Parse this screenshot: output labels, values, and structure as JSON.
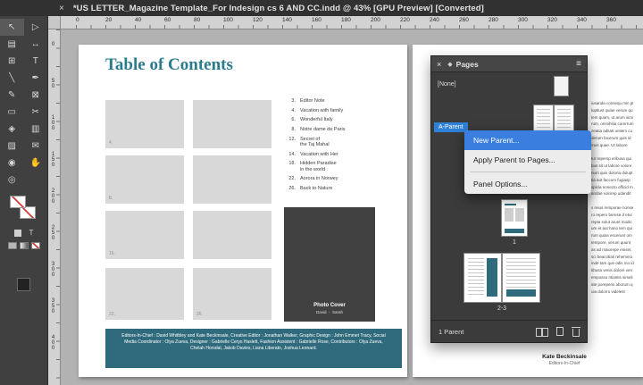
{
  "title_bar": {
    "close_glyph": "×",
    "title": "*US LETTER_Magazine Template_For Indesign cs 6 AND CC.indd @ 43% [GPU Preview] [Converted]"
  },
  "toolbar": {
    "tools": [
      {
        "name": "selection-tool",
        "glyph": "↖"
      },
      {
        "name": "direct-selection-tool",
        "glyph": "▷"
      },
      {
        "name": "page-tool",
        "glyph": "▤"
      },
      {
        "name": "gap-tool",
        "glyph": "↔"
      },
      {
        "name": "content-collector-tool",
        "glyph": "⊞"
      },
      {
        "name": "type-tool",
        "glyph": "T"
      },
      {
        "name": "line-tool",
        "glyph": "╲"
      },
      {
        "name": "pen-tool",
        "glyph": "✒"
      },
      {
        "name": "pencil-tool",
        "glyph": "✎"
      },
      {
        "name": "rectangle-frame-tool",
        "glyph": "⊠"
      },
      {
        "name": "rectangle-tool",
        "glyph": "▭"
      },
      {
        "name": "scissors-tool",
        "glyph": "✂"
      },
      {
        "name": "free-transform-tool",
        "glyph": "◈"
      },
      {
        "name": "gradient-swatch-tool",
        "glyph": "▥"
      },
      {
        "name": "gradient-feather-tool",
        "glyph": "▨"
      },
      {
        "name": "note-tool",
        "glyph": "✉"
      },
      {
        "name": "eyedropper-tool",
        "glyph": "◉"
      },
      {
        "name": "hand-tool",
        "glyph": "✋"
      },
      {
        "name": "zoom-tool",
        "glyph": "◎"
      },
      {
        "name": "blank-slot",
        "glyph": ""
      }
    ],
    "type_badge": "T"
  },
  "rulers": {
    "horizontal": [
      "0",
      "20",
      "40",
      "60",
      "80",
      "100",
      "120",
      "140",
      "160",
      "180",
      "200",
      "220",
      "240",
      "260",
      "280",
      "300",
      "320",
      "340",
      "360"
    ],
    "vertical": [
      "0",
      "50",
      "100",
      "150",
      "200",
      "250",
      "300",
      "350",
      "400"
    ]
  },
  "document": {
    "page1": {
      "title": "Table of Contents",
      "boxes": [
        "4.",
        "",
        "8.",
        "",
        "16.",
        "",
        "22.",
        "26."
      ],
      "toc": [
        {
          "num": "3.",
          "text": "Editor Note"
        },
        {
          "num": "4.",
          "text": "Vacation with family"
        },
        {
          "num": "6.",
          "text": "Wonderful Italy"
        },
        {
          "num": "8.",
          "text": "Notre dame de Paris"
        },
        {
          "num": "12.",
          "text": "Secret of\nthe Taj Mahal"
        },
        {
          "num": "14.",
          "text": "Vacation with Her"
        },
        {
          "num": "18.",
          "text": "Hidden Paradise\nin the world"
        },
        {
          "num": "22.",
          "text": "Aorora in Norwey"
        },
        {
          "num": "26.",
          "text": "Back to Nature"
        }
      ],
      "photo_cover": {
        "line1": "Photo Cover",
        "line2": "David  -  Sarah"
      },
      "footer": "Editors-In-Chief : David Whitbley and Kate Beckinsale, Creative Editor : Jonathan Walker, Graphic Design : John Emmet Tracy, Social Media Coordinator : Olya Zueva, Designer :  Gabrielle Cerys Haslett, Fashion Assistent : Gabrielle Rose, Contributors : Olya Zueva, Chelah Horsdal, Jakob Davies, Liana Liberato,  Joshua Leonard."
    },
    "page2": {
      "column_lines": [
        "iusanda consequ min pl",
        "luptiust quiae verum qu",
        "tem quam, ut arum simi",
        "rum, omnihitia corerrum",
        "zeatia aditati untiem cu",
        "derum facerum quis id",
        "mos quae. Ut labore",
        "",
        "tur repersp eribusa qui",
        "bus sit ut labore volore",
        "num quis doloria dolupt",
        "tia aut faccum fugiasp",
        "spicia nonecto officid m",
        "andae volorep udandit",
        "",
        "s reius remporae nonse",
        "ro repero berese d etur",
        "repta solut arunt modic",
        "um et aut hario tem qui",
        "rum quias escerunt om",
        "tempore, verum quunt",
        "as ad maiorepe eniset.",
        "sci bearcitiati rehemino",
        "inde tam que odis mo id",
        "tibusa venis dolore verr",
        "empossu ntiantis simeli",
        "ate poreperis aborum q",
        "uia dolorro videlest"
      ],
      "caption_name": "Kate Beckinsale",
      "caption_role": "Editors-In-Chief"
    }
  },
  "pages_panel": {
    "close_glyph": "×",
    "panel_icon": "◆",
    "title": "Pages",
    "menu_icon": "≡",
    "none_label": "[None]",
    "parent_label": "A-Parent",
    "page1_label": "1",
    "spread_label": "2-3",
    "status": "1 Parent",
    "context_menu": [
      "New Parent...",
      "Apply Parent to Pages...",
      "Panel Options..."
    ]
  },
  "colors": {
    "accent_teal": "#2a7b8d",
    "footer_teal": "#2f6b7c",
    "highlight_blue": "#2f80d9",
    "menu_highlight_blue": "#3a7fe0"
  }
}
